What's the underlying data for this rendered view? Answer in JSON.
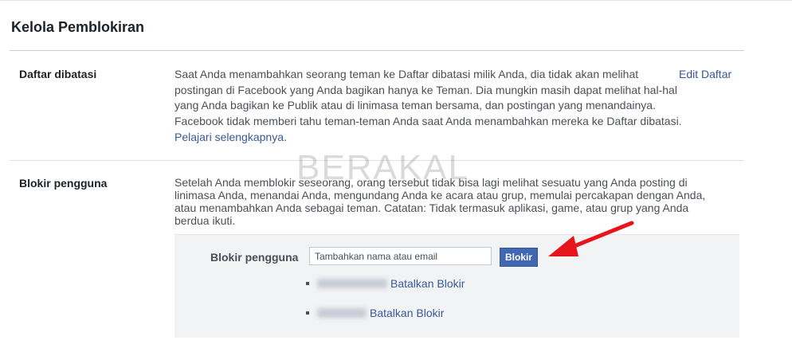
{
  "page_title": "Kelola Pemblokiran",
  "restricted": {
    "label": "Daftar dibatasi",
    "description": "Saat Anda menambahkan seorang teman ke Daftar dibatasi milik Anda, dia tidak akan melihat postingan di Facebook yang Anda bagikan hanya ke Teman. Dia mungkin masih dapat melihat hal-hal yang Anda bagikan ke Publik atau di linimasa teman bersama, dan postingan yang menandainya. Facebook tidak memberi tahu teman-teman Anda saat Anda menambahkan mereka ke Daftar dibatasi.",
    "learn_more": "Pelajari selengkapnya",
    "learn_more_suffix": ".",
    "edit_link": "Edit Daftar"
  },
  "block_users": {
    "label": "Blokir pengguna",
    "description": "Setelah Anda memblokir seseorang, orang tersebut tidak bisa lagi melihat sesuatu yang Anda posting di linimasa Anda, menandai Anda, mengundang Anda ke acara atau grup, memulai percakapan dengan Anda, atau menambahkan Anda sebagai teman. Catatan: Tidak termasuk aplikasi, game, atau grup yang Anda berdua ikuti.",
    "form_label": "Blokir pengguna",
    "input_placeholder": "Tambahkan nama atau email",
    "button_label": "Blokir",
    "blocked_list": [
      {
        "unblock_label": "Batalkan Blokir"
      },
      {
        "unblock_label": "Batalkan Blokir"
      }
    ]
  },
  "watermark": "BERAKAL",
  "colors": {
    "link": "#385898",
    "button": "#4267b2",
    "arrow": "#e8141b",
    "panel_bg": "#f2f3f5"
  }
}
